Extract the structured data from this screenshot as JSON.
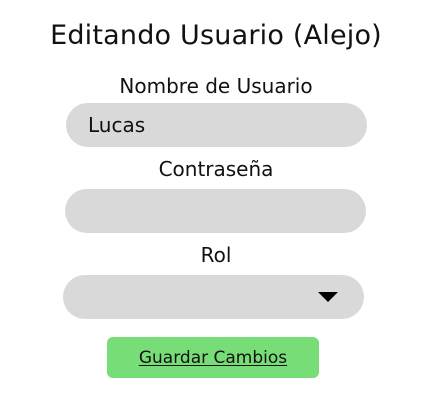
{
  "page": {
    "title": "Editando Usuario (Alejo)"
  },
  "form": {
    "username": {
      "label": "Nombre de Usuario",
      "value": "Lucas"
    },
    "password": {
      "label": "Contraseña",
      "value": ""
    },
    "role": {
      "label": "Rol",
      "selected": "",
      "icon": "chevron-down-icon"
    },
    "save_label": "Guardar Cambios"
  },
  "colors": {
    "field_background": "#d9d9d9",
    "button_background": "#77dd77",
    "text": "#111111"
  }
}
